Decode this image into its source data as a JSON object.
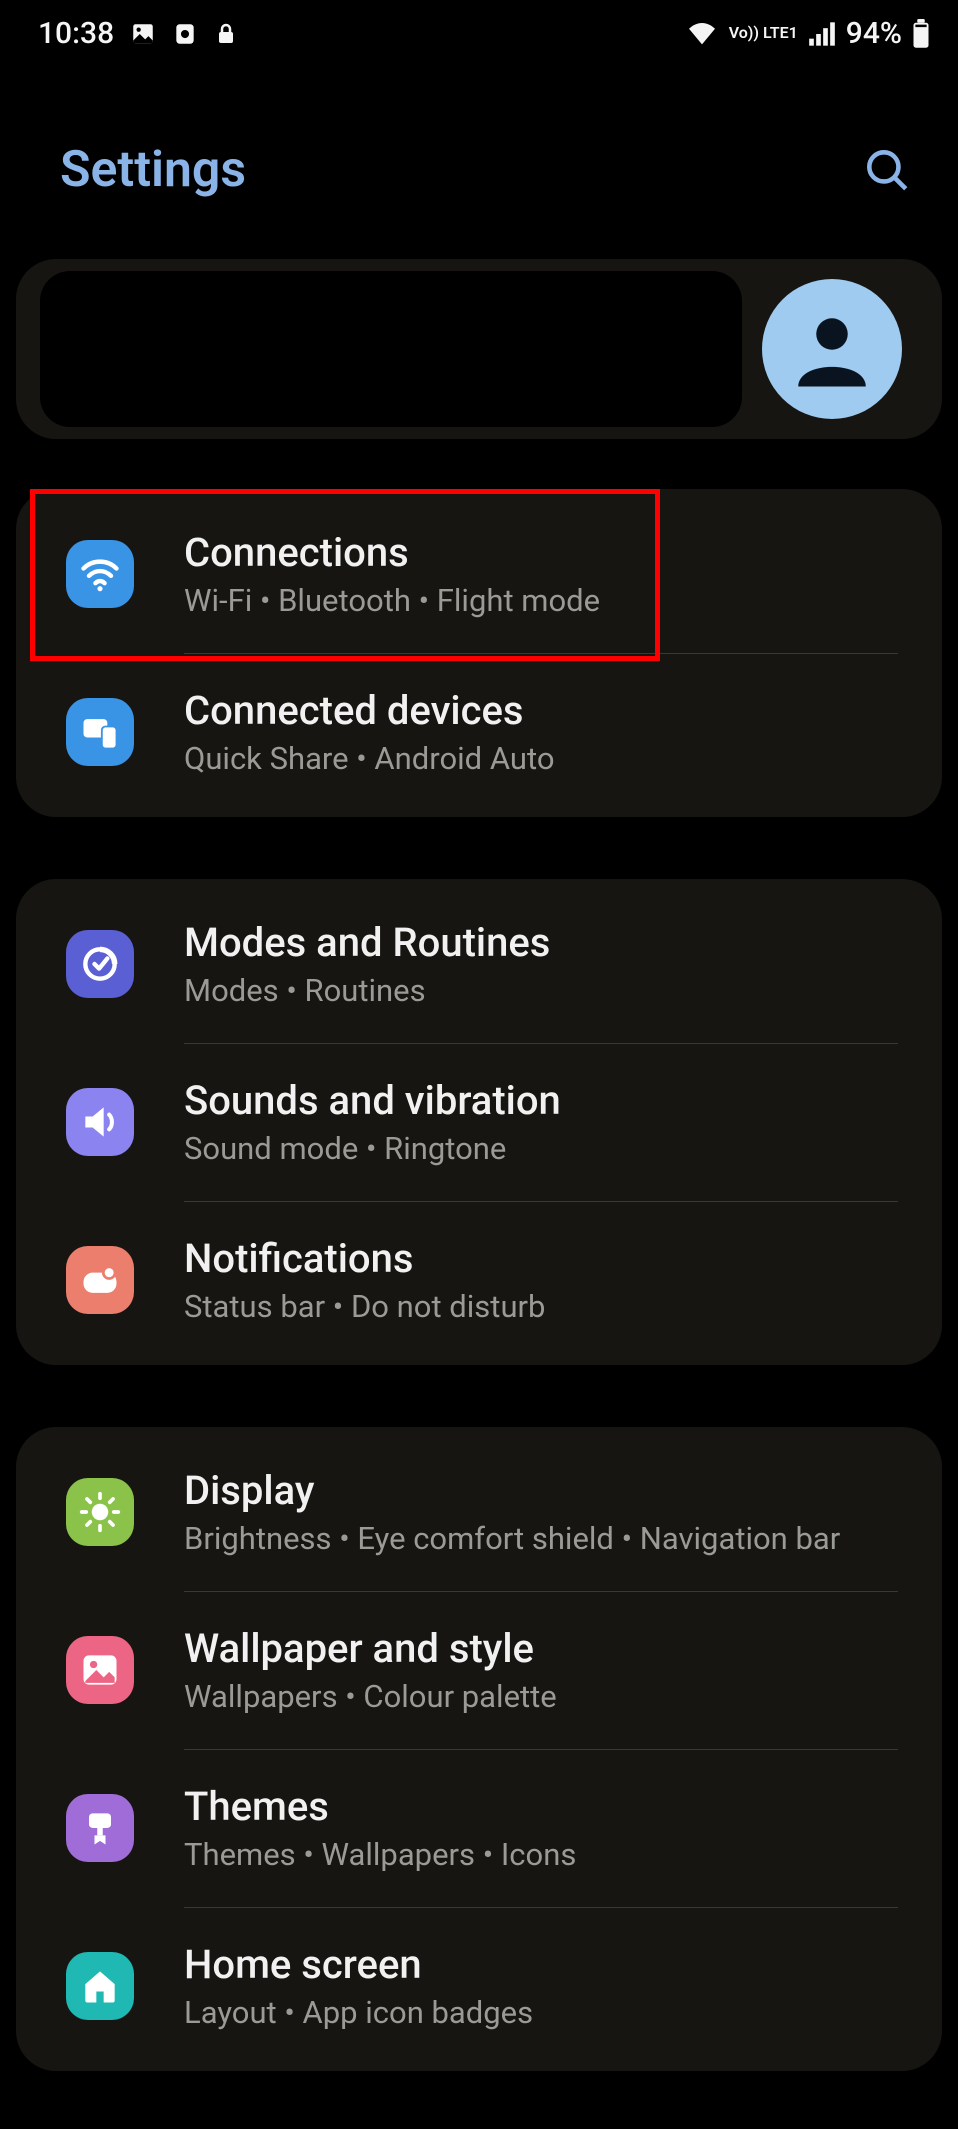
{
  "status": {
    "time": "10:38",
    "battery": "94%",
    "network_badge": "Vo)) LTE1"
  },
  "header": {
    "title": "Settings"
  },
  "groups": [
    {
      "items": [
        {
          "key": "connections",
          "title": "Connections",
          "subtitle": "Wi-Fi  •  Bluetooth  •  Flight mode",
          "icon_color": "ic-blue1",
          "icon": "wifi",
          "highlighted": true
        },
        {
          "key": "connected-devices",
          "title": "Connected devices",
          "subtitle": "Quick Share  •  Android Auto",
          "icon_color": "ic-blue2",
          "icon": "devices"
        }
      ]
    },
    {
      "items": [
        {
          "key": "modes-routines",
          "title": "Modes and Routines",
          "subtitle": "Modes  •  Routines",
          "icon_color": "ic-indigo",
          "icon": "target"
        },
        {
          "key": "sounds-vibration",
          "title": "Sounds and vibration",
          "subtitle": "Sound mode  •  Ringtone",
          "icon_color": "ic-violet",
          "icon": "speaker"
        },
        {
          "key": "notifications",
          "title": "Notifications",
          "subtitle": "Status bar  •  Do not disturb",
          "icon_color": "ic-coral",
          "icon": "notification"
        }
      ]
    },
    {
      "items": [
        {
          "key": "display",
          "title": "Display",
          "subtitle": "Brightness  •  Eye comfort shield  •  Navigation bar",
          "icon_color": "ic-green",
          "icon": "sun"
        },
        {
          "key": "wallpaper-style",
          "title": "Wallpaper and style",
          "subtitle": "Wallpapers  •  Colour palette",
          "icon_color": "ic-pink",
          "icon": "picture"
        },
        {
          "key": "themes",
          "title": "Themes",
          "subtitle": "Themes  •  Wallpapers  •  Icons",
          "icon_color": "ic-purple",
          "icon": "brush"
        },
        {
          "key": "home-screen",
          "title": "Home screen",
          "subtitle": "Layout  •  App icon badges",
          "icon_color": "ic-teal",
          "icon": "home"
        }
      ]
    }
  ]
}
